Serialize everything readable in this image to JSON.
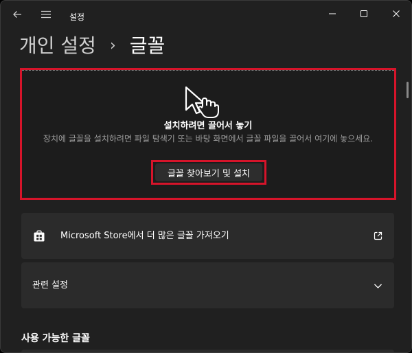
{
  "window": {
    "title": "설정"
  },
  "breadcrumb": {
    "parent": "개인 설정",
    "separator": "›",
    "current": "글꼴"
  },
  "dropzone": {
    "title": "설치하려면 끌어서 놓기",
    "description": "장치에 글꼴을 설치하려면 파일 탐색기 또는 바탕 화면에서 글꼴 파일을 끌어서 여기에 놓으세요.",
    "browse_label": "글꼴 찾아보기 및 설치",
    "highlight_color": "#d6142a"
  },
  "store_link": {
    "label": "Microsoft Store에서 더 많은 글꼴 가져오기",
    "icon": "store-icon"
  },
  "related_settings": {
    "label": "관련 설정",
    "icon": "chevron-down-icon"
  },
  "available_fonts": {
    "heading": "사용 가능한 글꼴"
  },
  "colors": {
    "background": "#202020",
    "card": "#2b2b2b",
    "accent_red": "#d6142a"
  }
}
